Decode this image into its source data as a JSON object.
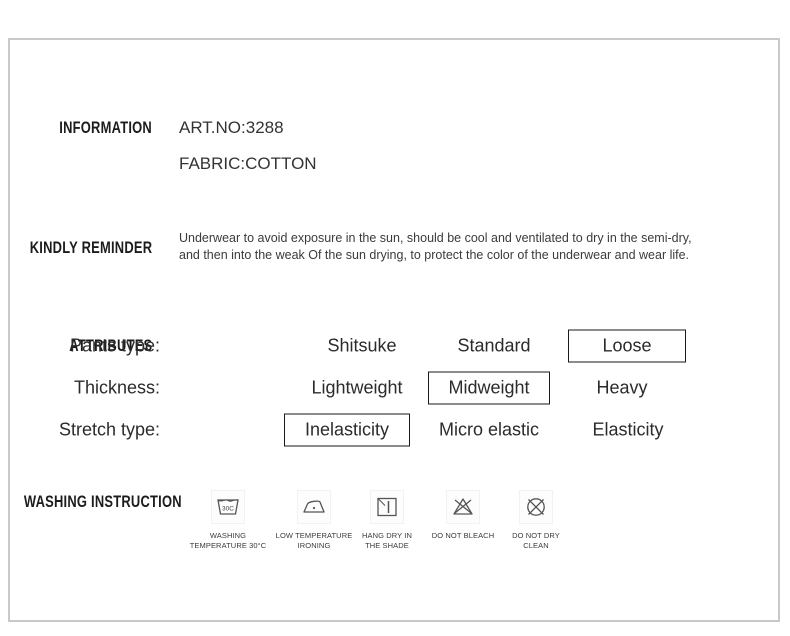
{
  "page": {
    "background_color": "#ffffff",
    "frame_border_color": "#c9c9c9"
  },
  "information": {
    "label": "INFORMATION",
    "lines": [
      "ART.NO:3288",
      "FABRIC:COTTON"
    ]
  },
  "kindly_reminder": {
    "label": "KINDLY REMINDER",
    "lines": [
      "Underwear to avoid exposure in the sun, should be cool and ventilated to dry in the semi-dry,",
      "and then into the weak Of the sun drying, to protect the color of the underwear and wear life."
    ]
  },
  "attributes": {
    "label": "ATTRIBUTES",
    "rows": [
      {
        "name": "Pants type:",
        "options": [
          {
            "label": "Shitsuke",
            "selected": false
          },
          {
            "label": "Standard",
            "selected": false
          },
          {
            "label": "Loose",
            "selected": true
          }
        ]
      },
      {
        "name": "Thickness:",
        "options": [
          {
            "label": "Lightweight",
            "selected": false
          },
          {
            "label": "Midweight",
            "selected": true
          },
          {
            "label": "Heavy",
            "selected": false
          }
        ]
      },
      {
        "name": "Stretch type:",
        "options": [
          {
            "label": "Inelasticity",
            "selected": true
          },
          {
            "label": "Micro elastic",
            "selected": false
          },
          {
            "label": "Elasticity",
            "selected": false
          }
        ]
      }
    ]
  },
  "washing_instruction": {
    "label": "WASHING INSTRUCTION",
    "icons": [
      {
        "icon": "wash-tub-30c-icon",
        "temperature": "30C",
        "caption": "WASHING\nTEMPERATURE 30°C"
      },
      {
        "icon": "iron-low-temperature-icon",
        "caption": "LOW TEMPERATURE\nIRONING"
      },
      {
        "icon": "hang-dry-in-shade-icon",
        "caption": "HANG DRY IN\nTHE SHADE"
      },
      {
        "icon": "do-not-bleach-icon",
        "caption": "DO NOT BLEACH"
      },
      {
        "icon": "do-not-dry-clean-icon",
        "caption": "DO NOT DRY\nCLEAN"
      }
    ]
  }
}
